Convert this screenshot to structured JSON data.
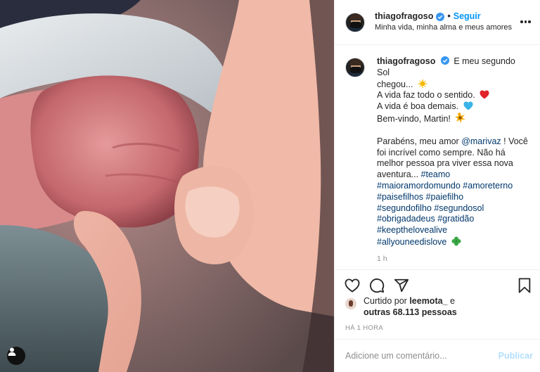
{
  "post": {
    "username": "thiagofragoso",
    "follow_label": "Seguir",
    "separator": "•",
    "location": "Minha vida, minha alma e meus amores"
  },
  "caption": {
    "username": "thiagofragoso",
    "line1": "E meu segundo Sol",
    "line2": "chegou...",
    "line3": "A vida faz todo o sentido.",
    "line4": "A vida é boa demais.",
    "line5": "Bem-vindo, Martin!",
    "p2_line1_a": "Parabéns, meu amor ",
    "mention": "@marivaz",
    "p2_line1_b": " ! Você",
    "p2_line2": "foi incrível como sempre. Não há",
    "p2_line3": "melhor pessoa pra viver essa nova",
    "p2_line4_a": "aventura... ",
    "tag_teamo": "#teamo",
    "tag_maioramor": "#maioramordomundo",
    "tag_amoreterno": "#amoreterno",
    "tag_paisefilhos": "#paisefilhos",
    "tag_paiefilho": "#paiefilho",
    "tag_segundofilho": "#segundofilho",
    "tag_segundosol": "#segundosol",
    "tag_obrigadadeus": "#obrigadadeus",
    "tag_gratidao": "#gratidão",
    "tag_keepthelove": "#keepthelovealive",
    "tag_allyouneed": "#allyouneedislove",
    "time": "1 h"
  },
  "likes": {
    "prefix": "Curtido por ",
    "user": "leemota_",
    "middle": " e",
    "others": "outras 68.113 pessoas"
  },
  "date_label": "HÁ 1 HORA",
  "comment": {
    "placeholder": "Adicione um comentário...",
    "publish_label": "Publicar"
  },
  "colors": {
    "accent": "#0095f6",
    "link": "#00376b",
    "publish_disabled": "#b2dffc",
    "muted": "#8e8e8e"
  },
  "icons": {
    "verified": "verified-badge-icon",
    "more": "more-options-icon",
    "like": "heart-icon",
    "comment": "comment-icon",
    "share": "send-icon",
    "save": "bookmark-icon",
    "user_tag": "user-tag-icon",
    "emoji_sun": "sun-emoji-icon",
    "emoji_red_heart": "red-heart-emoji-icon",
    "emoji_blue_heart": "blue-heart-emoji-icon",
    "emoji_star": "sparkle-emoji-icon",
    "emoji_clover": "clover-emoji-icon"
  }
}
